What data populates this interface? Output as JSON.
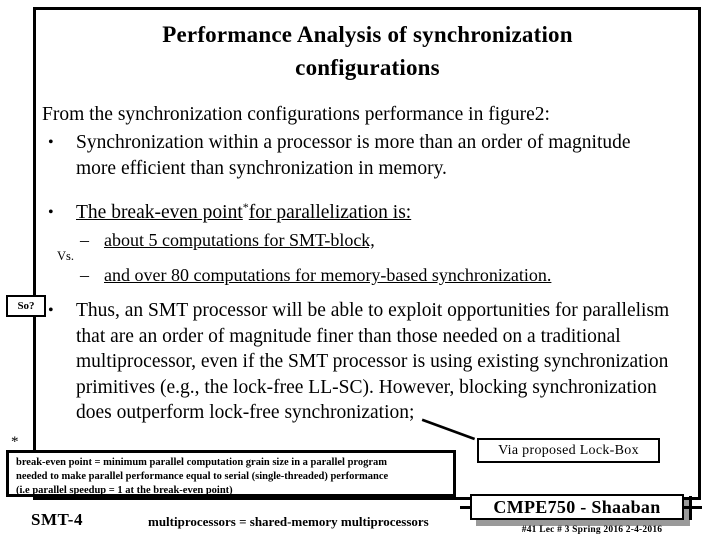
{
  "slide": {
    "title_line1": "Performance Analysis of synchronization",
    "title_line2": "configurations",
    "intro": "From the synchronization configurations performance in figure2:",
    "bullets": [
      {
        "marker": "•",
        "text": "Synchronization within a processor is more than an order of magnitude more efficient than synchronization in memory."
      },
      {
        "marker": "•",
        "text_before_star": "The break-even point",
        "star": "*",
        "text_after_star": "for parallelization is:"
      },
      {
        "marker": "•",
        "text": "Thus, an SMT processor will be able to exploit opportunities for parallelism that are an order of magnitude finer than those needed on a traditional multiprocessor, even if the SMT processor is using existing synchronization primitives (e.g., the lock-free LL-SC). However, blocking synchronization does outperform lock-free synchronization;"
      }
    ],
    "sub_bullets": [
      {
        "marker": "–",
        "text": "about 5 computations for SMT-block,"
      },
      {
        "marker": "–",
        "text": "and over 80 computations for memory-based synchronization."
      }
    ],
    "vs_label": "Vs.",
    "so_callout": "So?",
    "footnote_star": "*",
    "footnote": {
      "line1": "break-even point = minimum parallel computation grain size in a parallel program",
      "line2": "needed to make parallel performance equal to serial (single-threaded) performance",
      "line3": "(i.e parallel speedup  = 1 at the break-even point)"
    },
    "lockbox_note": "Via proposed Lock-Box",
    "smt4_label": "SMT-4",
    "multiprocessor_note": "multiprocessors = shared-memory multiprocessors",
    "footer": {
      "course": "CMPE750 - Shaaban",
      "meta": "#41   Lec # 3   Spring 2016  2-4-2016"
    }
  },
  "colors": {
    "text": "#000000",
    "background": "#ffffff",
    "shadow": "#9a9a9a",
    "border": "#000000"
  }
}
